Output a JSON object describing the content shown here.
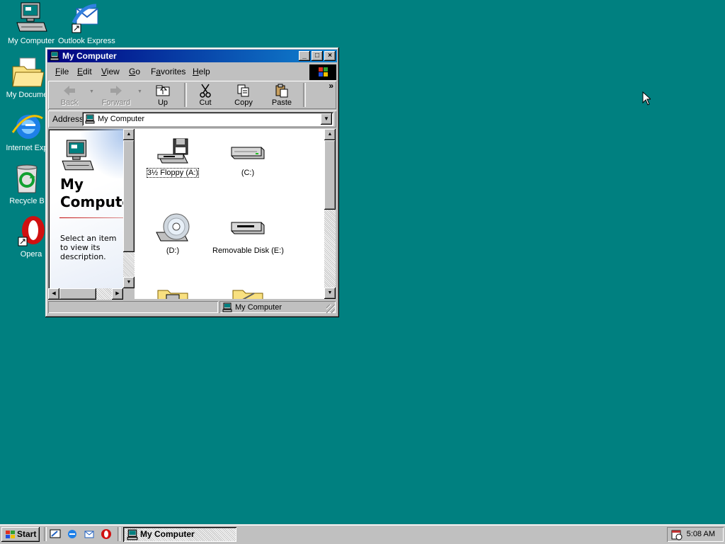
{
  "desktop": {
    "icons": [
      {
        "label": "My Computer"
      },
      {
        "label": "Outlook Express"
      },
      {
        "label": "My Docume"
      },
      {
        "label": "Internet Exp"
      },
      {
        "label": "Recycle B"
      },
      {
        "label": "Opera"
      }
    ]
  },
  "window": {
    "title": "My Computer",
    "controls": {
      "minimize": "_",
      "maximize": "□",
      "close": "×"
    },
    "menu": [
      {
        "prefix": "",
        "key": "F",
        "rest": "ile"
      },
      {
        "prefix": "",
        "key": "E",
        "rest": "dit"
      },
      {
        "prefix": "",
        "key": "V",
        "rest": "iew"
      },
      {
        "prefix": "",
        "key": "G",
        "rest": "o"
      },
      {
        "prefix": "F",
        "key": "a",
        "rest": "vorites"
      },
      {
        "prefix": "",
        "key": "H",
        "rest": "elp"
      }
    ],
    "toolbar": {
      "back": "Back",
      "forward": "Forward",
      "up": "Up",
      "cut": "Cut",
      "copy": "Copy",
      "paste": "Paste",
      "more": "»"
    },
    "address": {
      "label": "Address",
      "value": "My Computer"
    },
    "left_pane": {
      "title_line1": "My",
      "title_line2": "Computer",
      "description": "Select an item to view its description."
    },
    "files": [
      {
        "label": "3½ Floppy (A:)",
        "icon": "floppy-drive-icon",
        "selected": true
      },
      {
        "label": "(C:)",
        "icon": "hard-drive-icon"
      },
      {
        "label": "(D:)",
        "icon": "cd-drive-icon"
      },
      {
        "label": "Removable Disk (E:)",
        "icon": "removable-disk-icon"
      },
      {
        "label": "",
        "icon": "printers-folder-icon"
      },
      {
        "label": "",
        "icon": "control-panel-folder-icon"
      }
    ],
    "status": {
      "location": "My Computer"
    }
  },
  "taskbar": {
    "start": "Start",
    "quick_launch": [
      "show-desktop-icon",
      "internet-explorer-icon",
      "outlook-express-icon",
      "opera-icon"
    ],
    "task": "My Computer",
    "clock": "5:08 AM"
  }
}
